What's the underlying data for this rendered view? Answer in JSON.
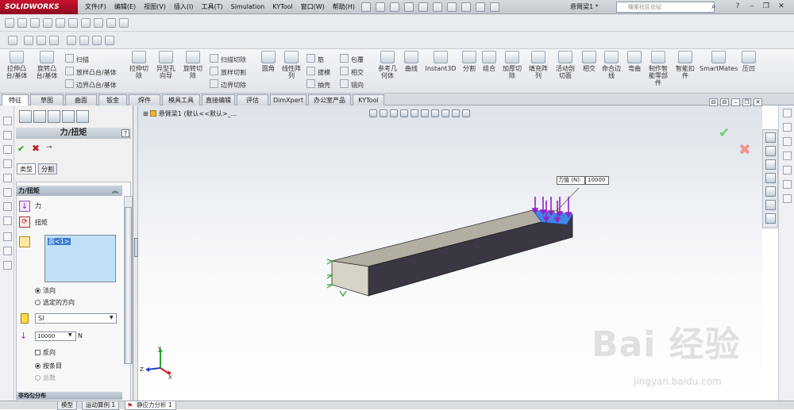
{
  "app": {
    "logo": "SOLIDWORKS",
    "document_title": "悬臂梁1 *"
  },
  "menu": [
    "文件(F)",
    "编辑(E)",
    "视图(V)",
    "插入(I)",
    "工具(T)",
    "Simulation",
    "KYTool",
    "窗口(W)",
    "帮助(H)"
  ],
  "search": {
    "placeholder": "搜索社区论坛"
  },
  "command_manager": {
    "large": [
      {
        "label": "拉伸凸\n台/基体"
      },
      {
        "label": "旋转凸\n台/基体"
      },
      {
        "label": "拉伸切\n除"
      },
      {
        "label": "异型孔\n向导"
      },
      {
        "label": "旋转切\n除"
      },
      {
        "label": "圆角"
      },
      {
        "label": "线性阵\n列"
      },
      {
        "label": "参考几\n何体"
      },
      {
        "label": "曲线"
      },
      {
        "label": "Instant3D"
      },
      {
        "label": "分割"
      },
      {
        "label": "组合"
      },
      {
        "label": "加厚切\n除"
      },
      {
        "label": "填充阵\n列"
      },
      {
        "label": "活动剖\n切面"
      },
      {
        "label": "相交"
      },
      {
        "label": "命合边\n线"
      },
      {
        "label": "弯曲"
      },
      {
        "label": "制作智\n能零部\n件"
      },
      {
        "label": "智能扣\n件"
      },
      {
        "label": "SmartMates"
      },
      {
        "label": "压凹"
      }
    ],
    "small": [
      "扫描",
      "放样凸台/基体",
      "边界凸台/基体",
      "扫描切除",
      "放样切割",
      "边界切除",
      "筋",
      "拔模",
      "抽壳",
      "包覆",
      "相交",
      "镜向"
    ]
  },
  "tabs": [
    "特征",
    "草图",
    "曲面",
    "钣金",
    "焊件",
    "模具工具",
    "直接编辑",
    "评估",
    "DimXpert",
    "办公室产品",
    "KYTool"
  ],
  "property_manager": {
    "title": "力/扭矩",
    "help": "?",
    "sub_tabs": [
      "类型",
      "分割"
    ],
    "group_title": "力/扭矩",
    "force_option": "力",
    "torque_option": "扭矩",
    "selection": "面<1>",
    "direction_normal": "法向",
    "direction_selected": "选定的方向",
    "unit_system": "SI",
    "force_value": "10000",
    "force_unit": "N",
    "reverse": "反向",
    "per_item": "按条目",
    "total": "总数",
    "nonuniform_group": "非均匀分布"
  },
  "graphics": {
    "feature_tree": "悬臂梁1  (默认<<默认>_...",
    "callout_label": "力值 (N):",
    "callout_value": "10000",
    "triad": {
      "x": "X",
      "y": "Y",
      "z": "Z"
    }
  },
  "bottom_tabs": [
    "模型",
    "运动算例 1",
    "静应力分析 1"
  ],
  "watermark": {
    "main": "Bai 经验",
    "url": "jingyan.baidu.com"
  },
  "colors": {
    "beam_top": "#b2aea4",
    "beam_front": "#3a3742",
    "beam_end": "#d7d3c8",
    "force_arrow": "#9a1ec8",
    "selected_face": "#3f86e8",
    "fixture": "#2aa52a"
  }
}
